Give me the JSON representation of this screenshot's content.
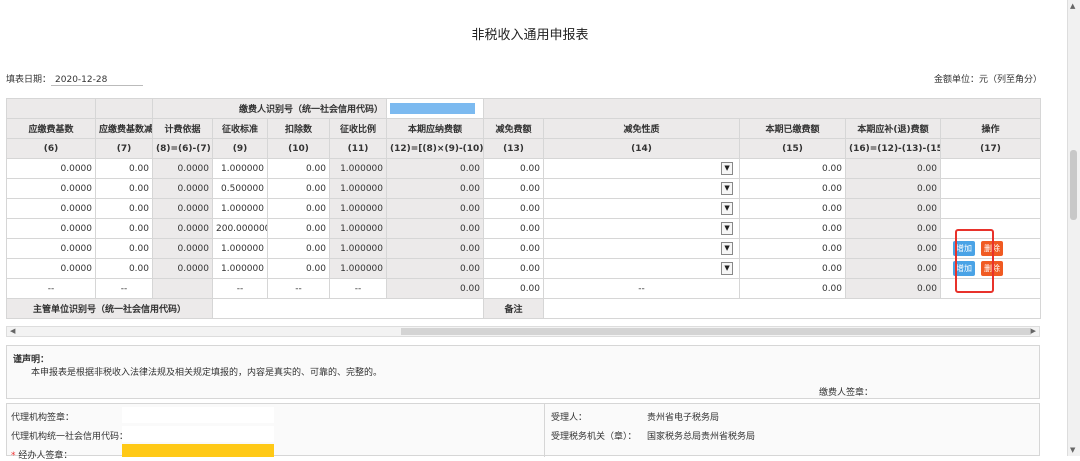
{
  "title": "非税收入通用申报表",
  "fill_date_label": "填表日期：",
  "fill_date": "2020-12-28",
  "unit_text": "金额单位：元（列至角分）",
  "taxpayer_id_label": "缴费人识别号（统一社会信用代码）",
  "headers": [
    "应缴费基数",
    "应缴费基数减除额",
    "计费依据",
    "征收标准",
    "扣除数",
    "征收比例",
    "本期应纳费额",
    "减免费额",
    "减免性质",
    "本期已缴费额",
    "本期应补(退)费额",
    "操作"
  ],
  "header_codes": [
    "(6)",
    "(7)",
    "(8)=(6)-(7)",
    "(9)",
    "(10)",
    "(11)",
    "(12)=[(8)×(9)-(10)]×(11)",
    "(13)",
    "(14)",
    "(15)",
    "(16)=(12)-(13)-(15)",
    "(17)"
  ],
  "rows": [
    {
      "c6": "0.0000",
      "c7": "0.00",
      "c8": "0.0000",
      "c9": "1.000000",
      "c10": "0.00",
      "c11": "1.000000",
      "c12": "0.00",
      "c13": "0.00",
      "c15": "0.00",
      "c16": "0.00"
    },
    {
      "c6": "0.0000",
      "c7": "0.00",
      "c8": "0.0000",
      "c9": "0.500000",
      "c10": "0.00",
      "c11": "1.000000",
      "c12": "0.00",
      "c13": "0.00",
      "c15": "0.00",
      "c16": "0.00"
    },
    {
      "c6": "0.0000",
      "c7": "0.00",
      "c8": "0.0000",
      "c9": "1.000000",
      "c10": "0.00",
      "c11": "1.000000",
      "c12": "0.00",
      "c13": "0.00",
      "c15": "0.00",
      "c16": "0.00"
    },
    {
      "c6": "0.0000",
      "c7": "0.00",
      "c8": "0.0000",
      "c9": "200.000000",
      "c10": "0.00",
      "c11": "1.000000",
      "c12": "0.00",
      "c13": "0.00",
      "c15": "0.00",
      "c16": "0.00"
    },
    {
      "c6": "0.0000",
      "c7": "0.00",
      "c8": "0.0000",
      "c9": "1.000000",
      "c10": "0.00",
      "c11": "1.000000",
      "c12": "0.00",
      "c13": "0.00",
      "c15": "0.00",
      "c16": "0.00"
    },
    {
      "c6": "0.0000",
      "c7": "0.00",
      "c8": "0.0000",
      "c9": "1.000000",
      "c10": "0.00",
      "c11": "1.000000",
      "c12": "0.00",
      "c13": "0.00",
      "c15": "0.00",
      "c16": "0.00"
    }
  ],
  "total_row": {
    "dash": "--",
    "c12": "0.00",
    "c13": "0.00",
    "c15": "0.00",
    "c16": "0.00"
  },
  "add_label": "增加",
  "delete_label": "删除",
  "supervisor_label": "主管单位识别号（统一社会信用代码）",
  "remark_label": "备注",
  "declaration_title": "谨声明：",
  "declaration_text": "本申报表是根据非税收入法律法规及相关规定填报的，内容是真实的、可靠的、完整的。",
  "payer_sign_label": "缴费人签章：",
  "agency_sign_label": "代理机构签章：",
  "agency_code_label": "代理机构统一社会信用代码：",
  "handler_sign_label": "经办人签章：",
  "receiver_label": "受理人：",
  "receiver_value": "贵州省电子税务局",
  "receiving_org_label": "受理税务机关（章）：",
  "receiving_org_value": "国家税务总局贵州省税务局"
}
